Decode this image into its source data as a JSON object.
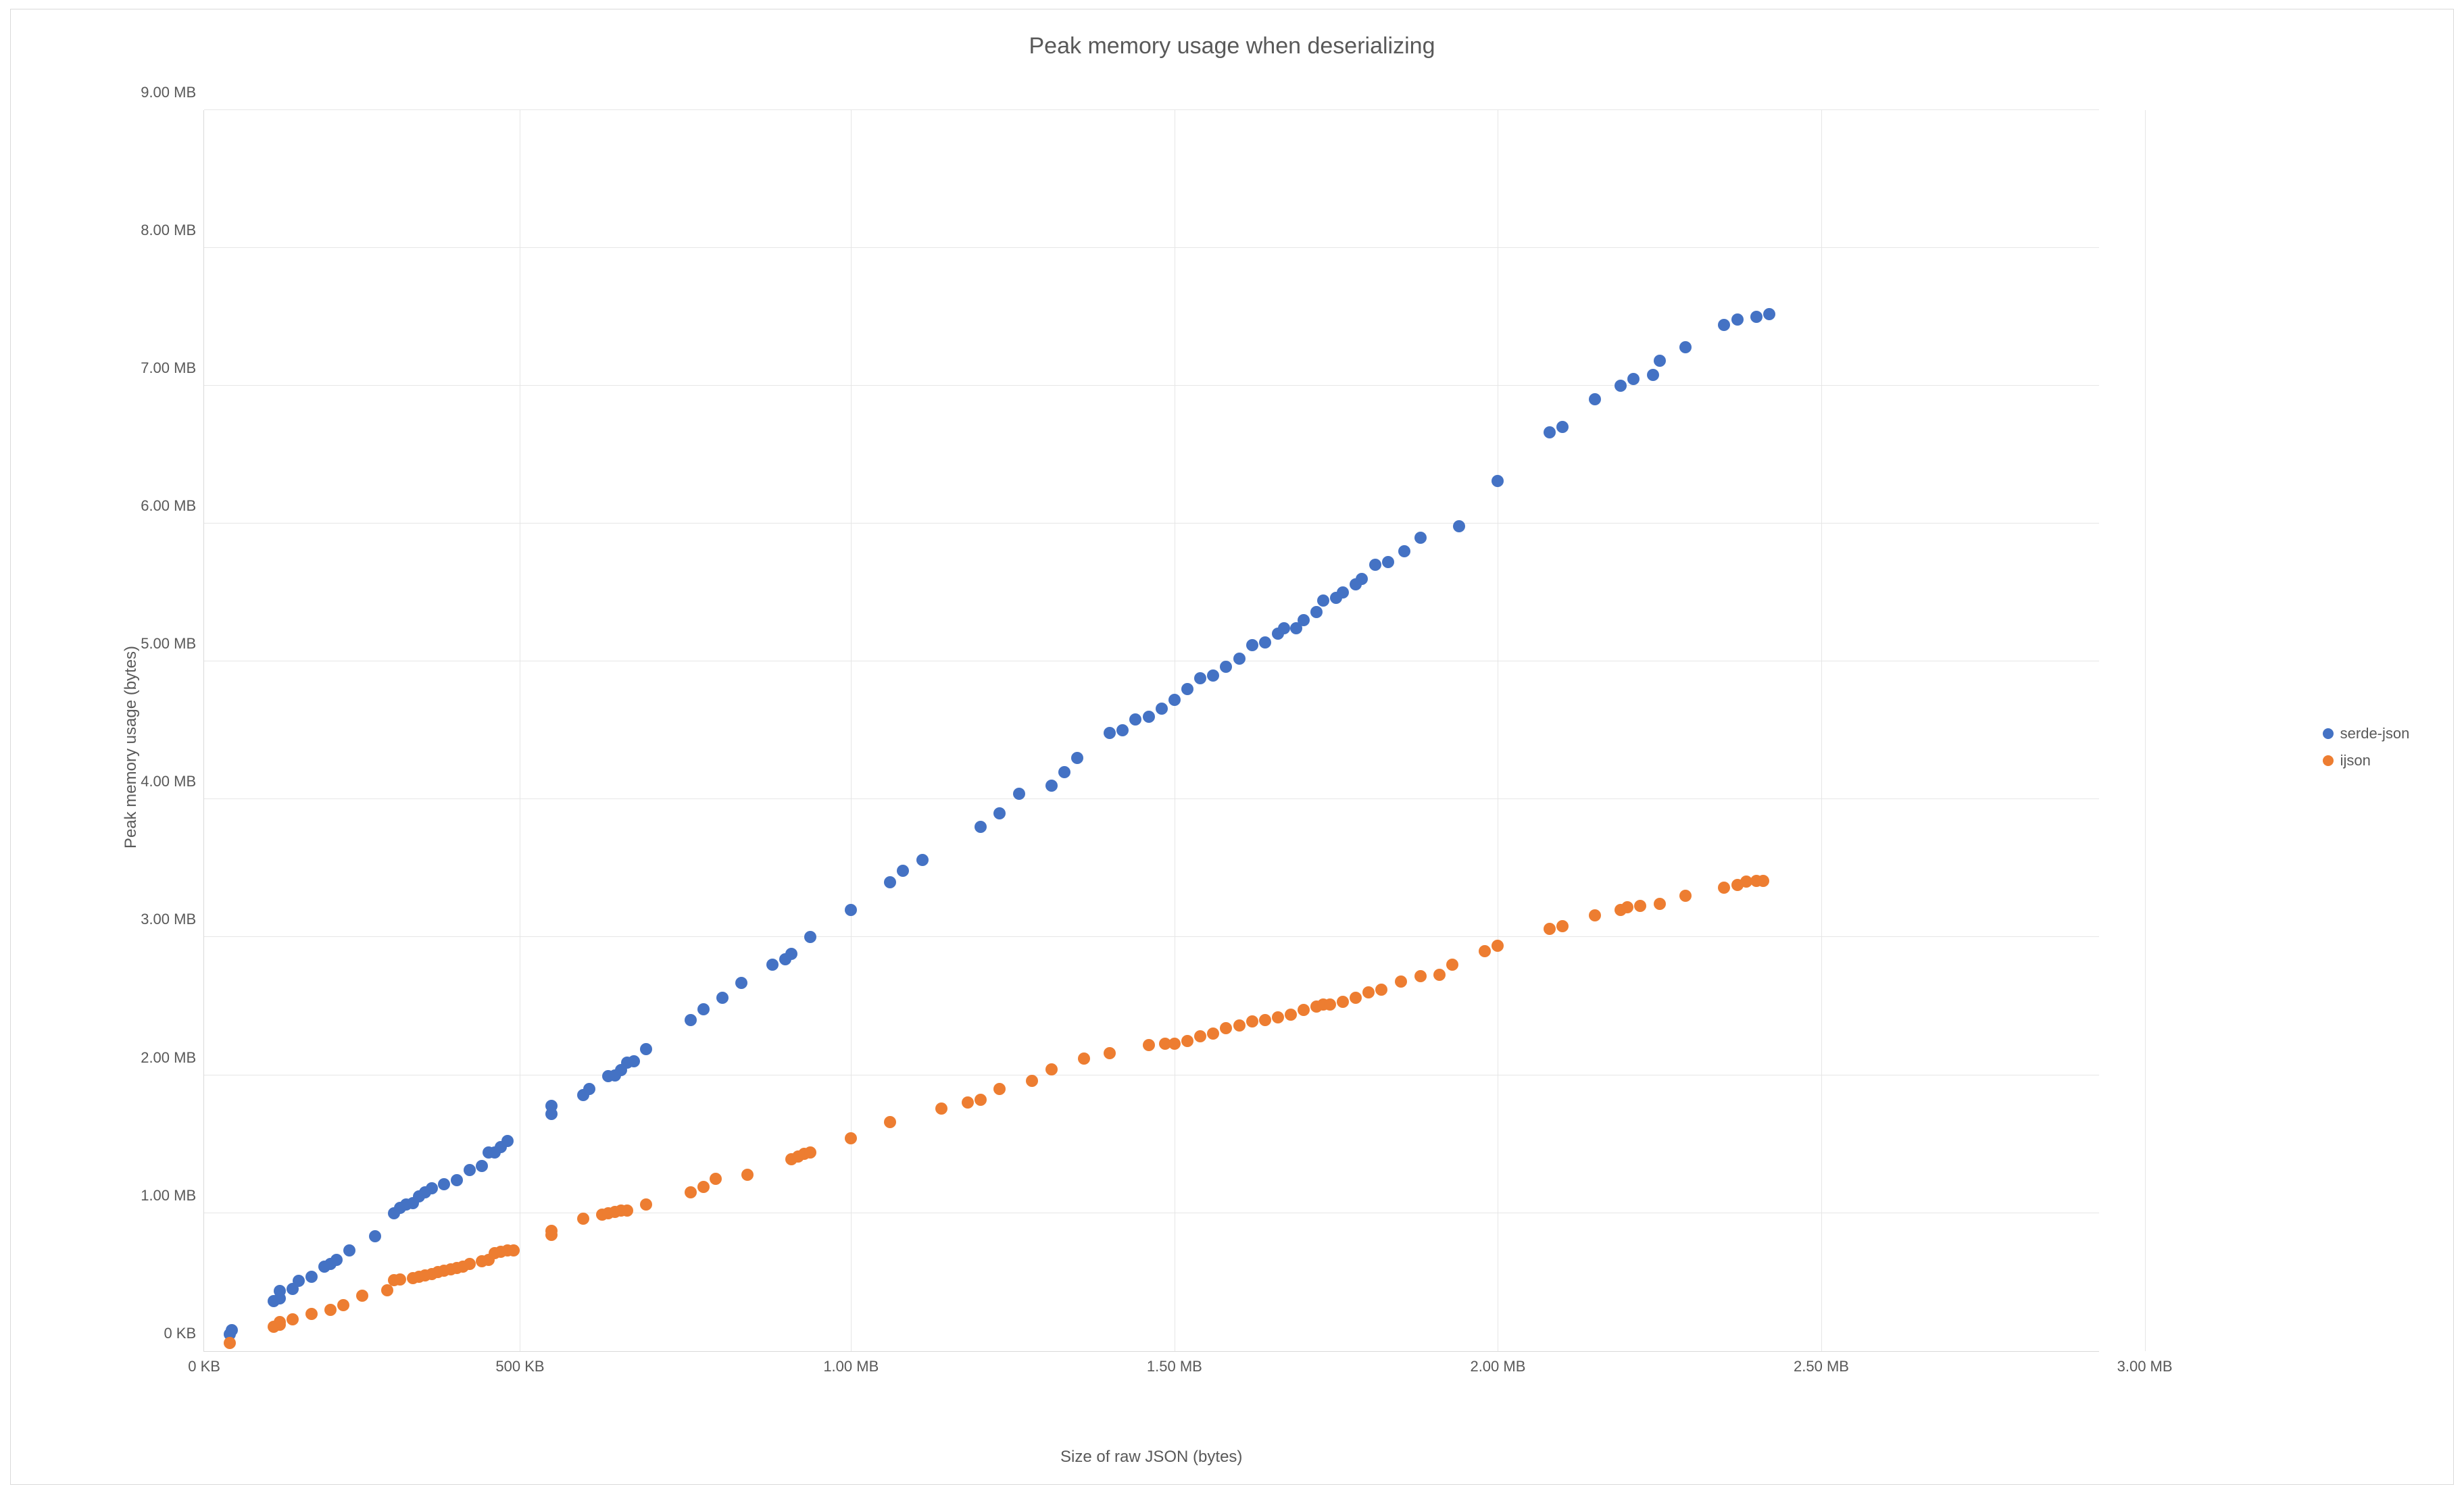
{
  "chart_data": {
    "type": "scatter",
    "title": "Peak memory usage when deserializing",
    "xlabel": "Size of raw JSON (bytes)",
    "ylabel": "Peak memory usage (bytes)",
    "xlim": [
      0,
      3072000
    ],
    "ylim": [
      0,
      9437184
    ],
    "x_ticks": [
      {
        "v": 0,
        "label": "0 KB"
      },
      {
        "v": 512000,
        "label": "500 KB"
      },
      {
        "v": 1048576,
        "label": "1.00 MB"
      },
      {
        "v": 1572864,
        "label": "1.50 MB"
      },
      {
        "v": 2097152,
        "label": "2.00 MB"
      },
      {
        "v": 2621440,
        "label": "2.50 MB"
      },
      {
        "v": 3145728,
        "label": "3.00 MB"
      }
    ],
    "y_ticks": [
      {
        "v": 0,
        "label": "0 KB"
      },
      {
        "v": 1048576,
        "label": "1.00 MB"
      },
      {
        "v": 2097152,
        "label": "2.00 MB"
      },
      {
        "v": 3145728,
        "label": "3.00 MB"
      },
      {
        "v": 4194304,
        "label": "4.00 MB"
      },
      {
        "v": 5242880,
        "label": "5.00 MB"
      },
      {
        "v": 6291456,
        "label": "6.00 MB"
      },
      {
        "v": 7340032,
        "label": "7.00 MB"
      },
      {
        "v": 8388608,
        "label": "8.00 MB"
      },
      {
        "v": 9437184,
        "label": "9.00 MB"
      }
    ],
    "series": [
      {
        "name": "serde-json",
        "color": "#4472c4",
        "radius": 9,
        "points": [
          [
            40960,
            125000
          ],
          [
            45000,
            160000
          ],
          [
            112640,
            377000
          ],
          [
            122880,
            400000
          ],
          [
            122880,
            455000
          ],
          [
            143360,
            471000
          ],
          [
            153600,
            535000
          ],
          [
            174080,
            566000
          ],
          [
            194560,
            640000
          ],
          [
            204800,
            660000
          ],
          [
            215040,
            692000
          ],
          [
            235520,
            765000
          ],
          [
            276480,
            870000
          ],
          [
            307200,
            1048576
          ],
          [
            317440,
            1090520
          ],
          [
            327680,
            1111490
          ],
          [
            337920,
            1121976
          ],
          [
            348160,
            1174405
          ],
          [
            358400,
            1205862
          ],
          [
            368640,
            1237320
          ],
          [
            389120,
            1268777
          ],
          [
            409600,
            1300234
          ],
          [
            430080,
            1373634
          ],
          [
            450560,
            1405092
          ],
          [
            460800,
            1510492
          ],
          [
            471040,
            1510492
          ],
          [
            481280,
            1552435
          ],
          [
            491520,
            1594378
          ],
          [
            563200,
            1804000
          ],
          [
            563200,
            1862270
          ],
          [
            614400,
            1946157
          ],
          [
            624640,
            1993342
          ],
          [
            655360,
            2087714
          ],
          [
            665600,
            2097152
          ],
          [
            675840,
            2134900
          ],
          [
            686080,
            2192570
          ],
          [
            696320,
            2202010
          ],
          [
            716800,
            2296380
          ],
          [
            788480,
            2516582
          ],
          [
            808960,
            2600468
          ],
          [
            839680,
            2684354
          ],
          [
            870400,
            2800000
          ],
          [
            921600,
            2935010
          ],
          [
            942080,
            2977955
          ],
          [
            952320,
            3019898
          ],
          [
            983040,
            3145728
          ],
          [
            1048576,
            3355443
          ],
          [
            1111490,
            3565158
          ],
          [
            1132462,
            3649044
          ],
          [
            1163919,
            3732930
          ],
          [
            1258291,
            3984589
          ],
          [
            1289748,
            4089446
          ],
          [
            1321205,
            4236247
          ],
          [
            1373634,
            4299162
          ],
          [
            1394606,
            4404020
          ],
          [
            1415578,
            4508877
          ],
          [
            1468006,
            4697620
          ],
          [
            1488978,
            4718592
          ],
          [
            1509949,
            4802478
          ],
          [
            1530921,
            4823449
          ],
          [
            1551892,
            4886364
          ],
          [
            1572864,
            4949278
          ],
          [
            1593836,
            5033164
          ],
          [
            1614807,
            5117050
          ],
          [
            1635779,
            5138022
          ],
          [
            1656750,
            5200937
          ],
          [
            1677722,
            5263852
          ],
          [
            1698693,
            5368709
          ],
          [
            1719665,
            5389680
          ],
          [
            1740636,
            5452594
          ],
          [
            1750000,
            5494537
          ],
          [
            1770000,
            5494537
          ],
          [
            1782579,
            5557452
          ],
          [
            1803551,
            5620367
          ],
          [
            1814036,
            5704253
          ],
          [
            1835008,
            5725225
          ],
          [
            1845494,
            5767167
          ],
          [
            1866465,
            5830082
          ],
          [
            1876950,
            5872025
          ],
          [
            1897922,
            5976883
          ],
          [
            1918894,
            5997854
          ],
          [
            1945108,
            6081741
          ],
          [
            1971323,
            6186598
          ],
          [
            2034237,
            6270485
          ],
          [
            2097152,
            6616515
          ],
          [
            2181038,
            6983516
          ],
          [
            2202010,
            7025459
          ],
          [
            2254438,
            7235175
          ],
          [
            2296381,
            7340032
          ],
          [
            2317353,
            7392461
          ],
          [
            2348810,
            7424000
          ],
          [
            2359296,
            7529000
          ],
          [
            2401239,
            7633000
          ],
          [
            2464154,
            7801405
          ],
          [
            2485125,
            7843348
          ],
          [
            2516582,
            7864320
          ],
          [
            2537554,
            7885291
          ]
        ]
      },
      {
        "name": "ijson",
        "color": "#ed7d31",
        "radius": 9,
        "points": [
          [
            40960,
            60900
          ],
          [
            112640,
            185000
          ],
          [
            122880,
            199230
          ],
          [
            122880,
            220200
          ],
          [
            143360,
            241170
          ],
          [
            174080,
            283115
          ],
          [
            204800,
            314573
          ],
          [
            225280,
            346030
          ],
          [
            256000,
            419430
          ],
          [
            296960,
            461373
          ],
          [
            307200,
            540016
          ],
          [
            317440,
            545259
          ],
          [
            337920,
            555745
          ],
          [
            348160,
            566231
          ],
          [
            358400,
            576717
          ],
          [
            368640,
            587203
          ],
          [
            378880,
            597688
          ],
          [
            389120,
            608174
          ],
          [
            399360,
            618660
          ],
          [
            409600,
            629146
          ],
          [
            419840,
            639631
          ],
          [
            430080,
            660602
          ],
          [
            450560,
            681574
          ],
          [
            460800,
            692060
          ],
          [
            471040,
            744489
          ],
          [
            481280,
            754975
          ],
          [
            491520,
            765461
          ],
          [
            501760,
            765461
          ],
          [
            563200,
            880804
          ],
          [
            563200,
            912262
          ],
          [
            614400,
            1006632
          ],
          [
            645120,
            1038090
          ],
          [
            655360,
            1048576
          ],
          [
            665600,
            1059062
          ],
          [
            675840,
            1069548
          ],
          [
            686080,
            1069548
          ],
          [
            716800,
            1111490
          ],
          [
            788480,
            1205862
          ],
          [
            808960,
            1247804
          ],
          [
            829440,
            1310720
          ],
          [
            880640,
            1342178
          ],
          [
            952320,
            1457521
          ],
          [
            962560,
            1478492
          ],
          [
            972800,
            1499464
          ],
          [
            983040,
            1509949
          ],
          [
            1048576,
            1614807
          ],
          [
            1111490,
            1740636
          ],
          [
            1195377,
            1845494
          ],
          [
            1237319,
            1887437
          ],
          [
            1258291,
            1908408
          ],
          [
            1289748,
            1992294
          ],
          [
            1342177,
            2055209
          ],
          [
            1373634,
            2139095
          ],
          [
            1426063,
            2223981
          ],
          [
            1468006,
            2265924
          ],
          [
            1530921,
            2327839
          ],
          [
            1558000,
            2338325
          ],
          [
            1572864,
            2338325
          ],
          [
            1593836,
            2359296
          ],
          [
            1614807,
            2390753
          ],
          [
            1635779,
            2411725
          ],
          [
            1656750,
            2453668
          ],
          [
            1677722,
            2474639
          ],
          [
            1698693,
            2505096
          ],
          [
            1719665,
            2516582
          ],
          [
            1740636,
            2537554
          ],
          [
            1761608,
            2558525
          ],
          [
            1782579,
            2590983
          ],
          [
            1803551,
            2621440
          ],
          [
            1814036,
            2631926
          ],
          [
            1824522,
            2631926
          ],
          [
            1845494,
            2652897
          ],
          [
            1866465,
            2684354
          ],
          [
            1887437,
            2726298
          ],
          [
            1908408,
            2747269
          ],
          [
            1939866,
            2810184
          ],
          [
            1971323,
            2852127
          ],
          [
            2002780,
            2862613
          ],
          [
            2023752,
            2935013
          ],
          [
            2076180,
            3040870
          ],
          [
            2097152,
            3082813
          ],
          [
            2181038,
            3208643
          ],
          [
            2202010,
            3229614
          ],
          [
            2254438,
            3313500
          ],
          [
            2296381,
            3355443
          ],
          [
            2306867,
            3376414
          ],
          [
            2327839,
            3386900
          ],
          [
            2359296,
            3397386
          ],
          [
            2401239,
            3460301
          ],
          [
            2464154,
            3523216
          ],
          [
            2485125,
            3544188
          ],
          [
            2500000,
            3570402
          ],
          [
            2516582,
            3575645
          ],
          [
            2527068,
            3575645
          ]
        ]
      }
    ],
    "legend": [
      {
        "name": "serde-json",
        "color": "#4472c4"
      },
      {
        "name": "ijson",
        "color": "#ed7d31"
      }
    ]
  }
}
